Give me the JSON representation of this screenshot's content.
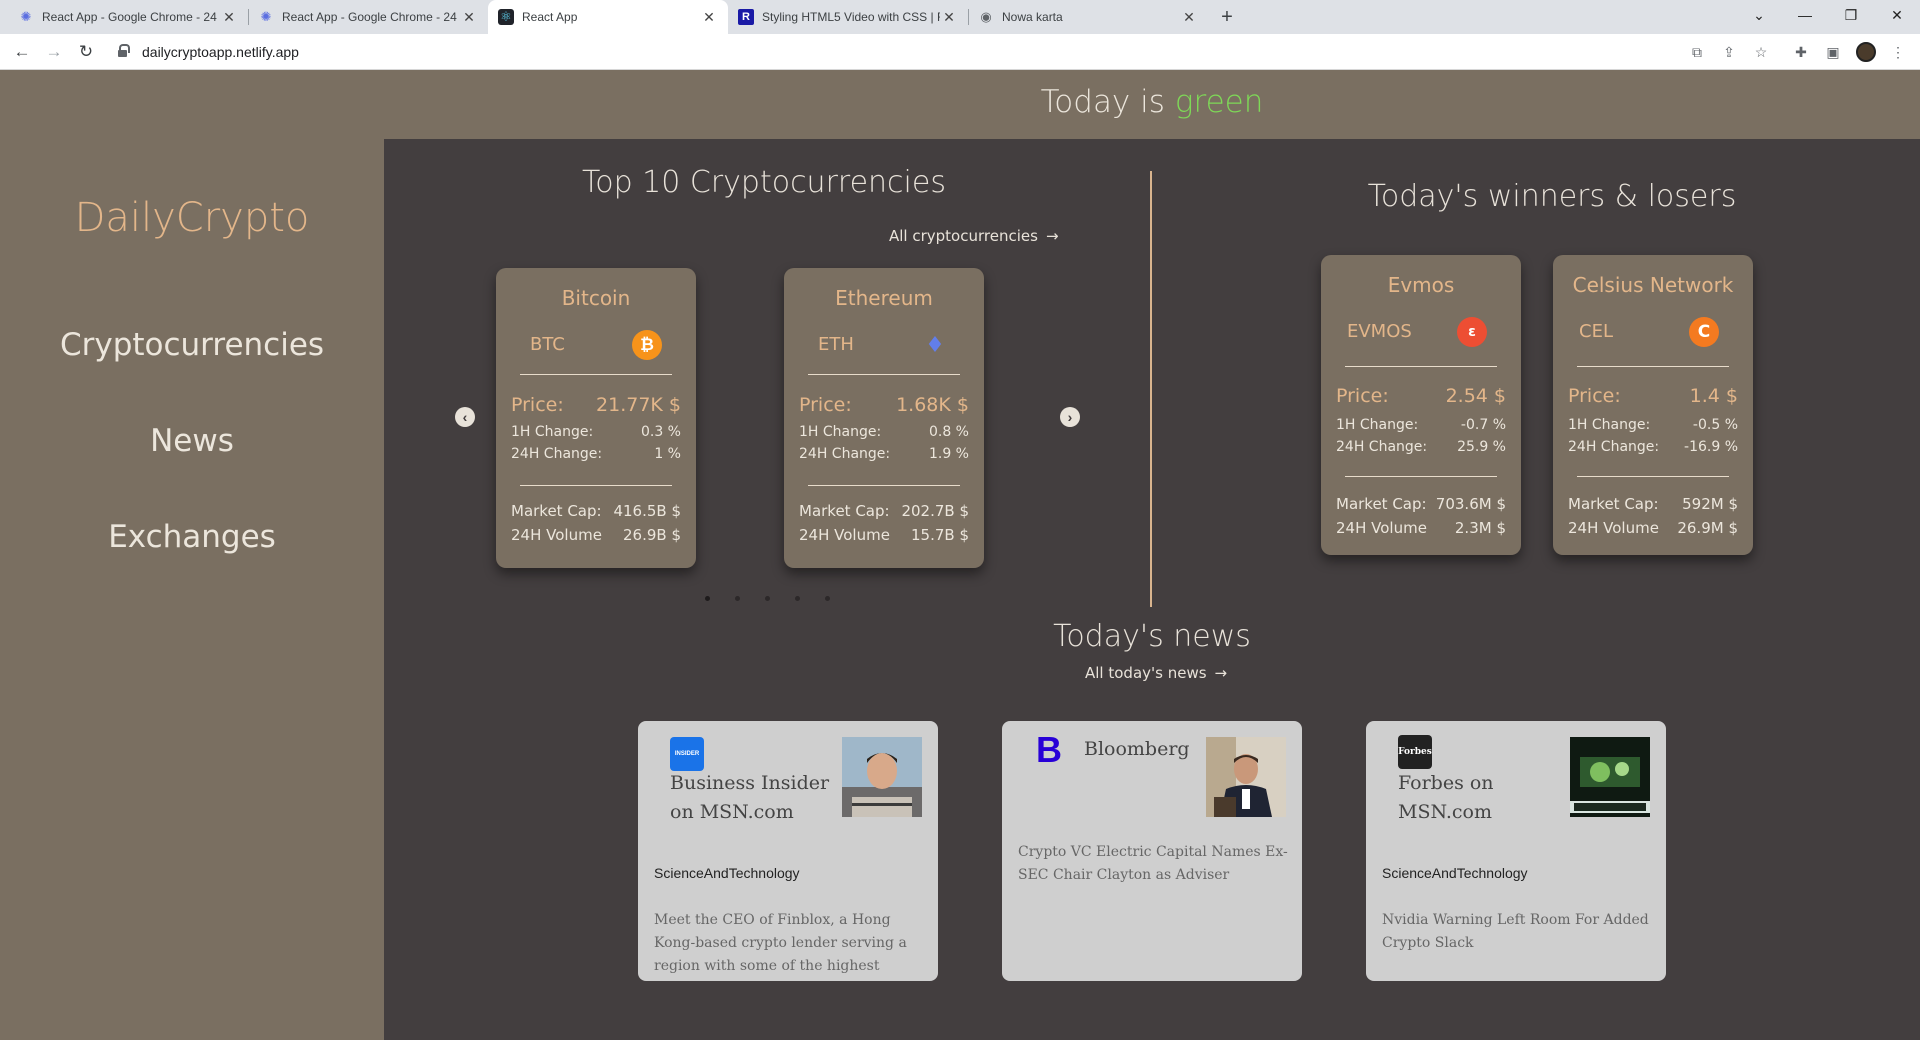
{
  "browser": {
    "tabs": [
      {
        "title": "React App - Google Chrome - 24",
        "icon": "react-icon",
        "active": false
      },
      {
        "title": "React App - Google Chrome - 24",
        "icon": "react-icon",
        "active": false
      },
      {
        "title": "React App",
        "icon": "react-icon",
        "active": true
      },
      {
        "title": "Styling HTML5 Video with CSS | F",
        "icon": "r-site-icon",
        "active": false
      },
      {
        "title": "Nowa karta",
        "icon": "chrome-icon",
        "active": false
      }
    ],
    "url": "dailycryptoapp.netlify.app"
  },
  "header": {
    "prefix": "Today is",
    "value": "green",
    "value_color": "#7ed957"
  },
  "sidebar": {
    "logo": "DailyCrypto",
    "nav": [
      {
        "label": "Cryptocurrencies"
      },
      {
        "label": "News"
      },
      {
        "label": "Exchanges"
      }
    ]
  },
  "top10": {
    "title": "Top 10 Cryptocurrencies",
    "link": "All cryptocurrencies",
    "cards": [
      {
        "name": "Bitcoin",
        "symbol": "BTC",
        "icon": "bitcoin-icon",
        "icon_color": "#f7931a",
        "price_label": "Price:",
        "price": "21.77K $",
        "h1_label": "1H Change:",
        "h1": "0.3 %",
        "h24_label": "24H Change:",
        "h24": "1 %",
        "mcap_label": "Market Cap:",
        "mcap": "416.5B $",
        "vol_label": "24H Volume",
        "vol": "26.9B $"
      },
      {
        "name": "Ethereum",
        "symbol": "ETH",
        "icon": "ethereum-icon",
        "icon_color": "#627eea",
        "price_label": "Price:",
        "price": "1.68K $",
        "h1_label": "1H Change:",
        "h1": "0.8 %",
        "h24_label": "24H Change:",
        "h24": "1.9 %",
        "mcap_label": "Market Cap:",
        "mcap": "202.7B $",
        "vol_label": "24H Volume",
        "vol": "15.7B $"
      }
    ],
    "pages": 5,
    "active_page": 1
  },
  "winners": {
    "title": "Today's winners & losers",
    "cards": [
      {
        "name": "Evmos",
        "symbol": "EVMOS",
        "icon": "evmos-icon",
        "icon_color": "#ed4e33",
        "price_label": "Price:",
        "price": "2.54 $",
        "h1_label": "1H Change:",
        "h1": "-0.7 %",
        "h24_label": "24H Change:",
        "h24": "25.9 %",
        "mcap_label": "Market Cap:",
        "mcap": "703.6M $",
        "vol_label": "24H Volume",
        "vol": "2.3M $"
      },
      {
        "name": "Celsius Network",
        "symbol": "CEL",
        "icon": "celsius-icon",
        "icon_color": "#f47a20",
        "price_label": "Price:",
        "price": "1.4 $",
        "h1_label": "1H Change:",
        "h1": "-0.5 %",
        "h24_label": "24H Change:",
        "h24": "-16.9 %",
        "mcap_label": "Market Cap:",
        "mcap": "592M $",
        "vol_label": "24H Volume",
        "vol": "26.9M $"
      }
    ]
  },
  "news": {
    "title": "Today's news",
    "link": "All today's news",
    "items": [
      {
        "provider": "Business Insider on MSN.com",
        "provider_logo": "insider-logo-icon",
        "logo_text": "INSIDER",
        "category": "ScienceAndTechnology",
        "description": "Meet the CEO of Finblox, a Hong Kong-based crypto lender serving a region with some of the highest fintech"
      },
      {
        "provider": "Bloomberg",
        "provider_logo": "bloomberg-logo-icon",
        "logo_text": "B",
        "category": "",
        "description": "Crypto VC Electric Capital Names Ex-SEC Chair Clayton as Adviser"
      },
      {
        "provider": "Forbes on MSN.com",
        "provider_logo": "forbes-logo-icon",
        "logo_text": "Forbes",
        "category": "ScienceAndTechnology",
        "description": "Nvidia Warning Left Room For Added Crypto Slack"
      }
    ]
  }
}
